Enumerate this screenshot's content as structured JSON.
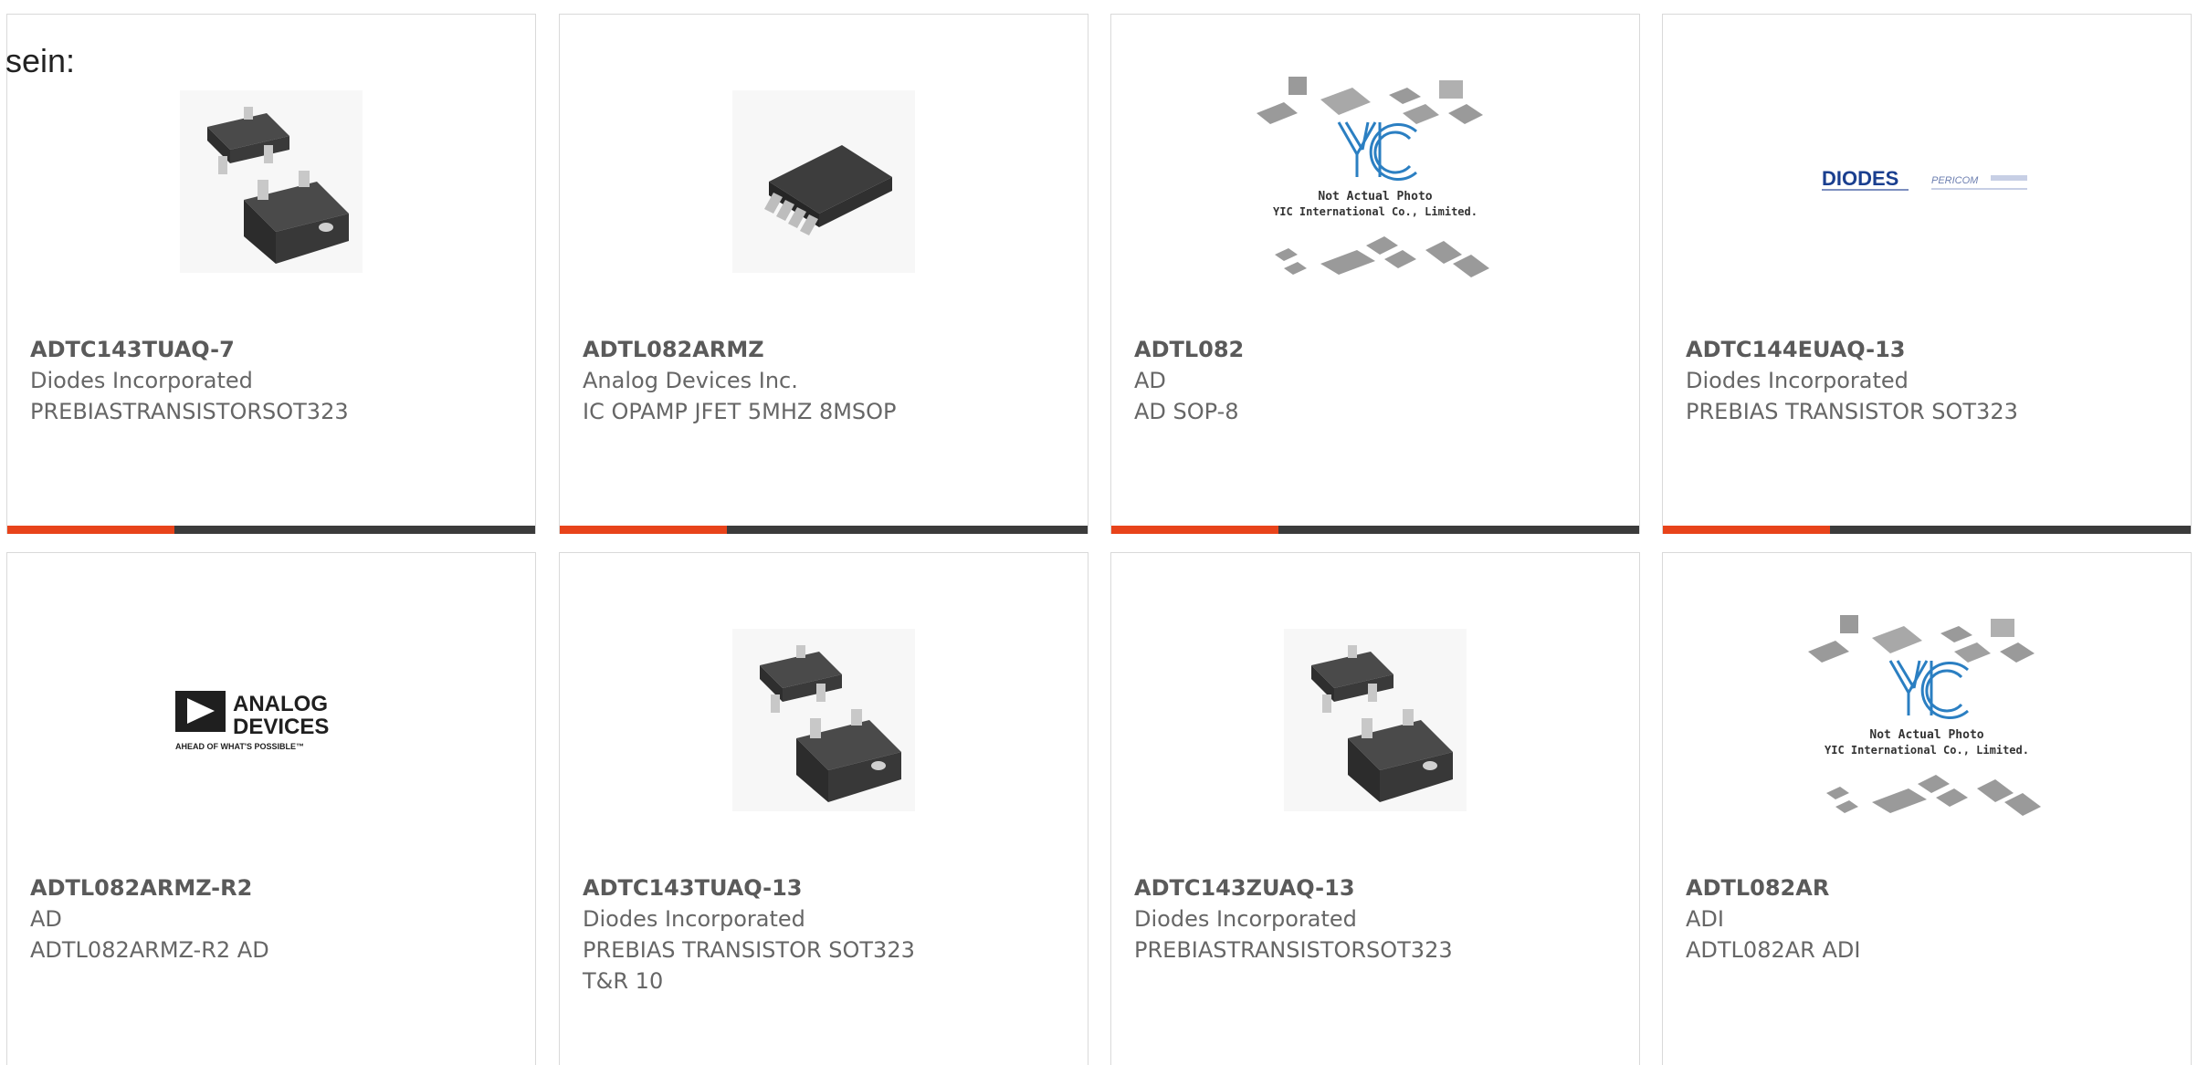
{
  "intro": {
    "text": "sein:"
  },
  "products": [
    {
      "part": "ADTC143TUAQ-7",
      "maker": "Diodes Incorporated",
      "desc": "PREBIASTRANSISTORSOT323",
      "image": "sot323-package-photo"
    },
    {
      "part": "ADTL082ARMZ",
      "maker": "Analog Devices Inc.",
      "desc": "IC OPAMP JFET 5MHZ 8MSOP",
      "image": "msop8-package-photo"
    },
    {
      "part": "ADTL082",
      "maker": "AD",
      "desc": "AD SOP-8",
      "image": "yic-placeholder",
      "placeholder_line1": "Not Actual Photo",
      "placeholder_line2": "YIC International Co., Limited."
    },
    {
      "part": "ADTC144EUAQ-13",
      "maker": "Diodes Incorporated",
      "desc": "PREBIAS TRANSISTOR SOT323",
      "image": "diodes-pericom-logo",
      "logo_text_1": "DIODES",
      "logo_text_2": "PERICOM"
    },
    {
      "part": "ADTL082ARMZ-R2",
      "maker": "AD",
      "desc": "ADTL082ARMZ-R2 AD",
      "image": "analog-devices-logo",
      "logo_text_1": "ANALOG",
      "logo_text_2": "DEVICES",
      "logo_tagline": "AHEAD OF WHAT'S POSSIBLE™"
    },
    {
      "part": "ADTC143TUAQ-13",
      "maker": "Diodes Incorporated",
      "desc": "PREBIAS TRANSISTOR SOT323",
      "desc2": "T&R 10",
      "image": "sot323-package-photo"
    },
    {
      "part": "ADTC143ZUAQ-13",
      "maker": "Diodes Incorporated",
      "desc": "PREBIASTRANSISTORSOT323",
      "image": "sot323-package-photo"
    },
    {
      "part": "ADTL082AR",
      "maker": "ADI",
      "desc": "ADTL082AR ADI",
      "image": "yic-placeholder",
      "placeholder_line1": "Not Actual Photo",
      "placeholder_line2": "YIC International Co., Limited."
    }
  ],
  "colors": {
    "accent": "#e8431a",
    "bar": "#3b3b3b",
    "border": "#d9d9d9",
    "text": "#666666"
  }
}
